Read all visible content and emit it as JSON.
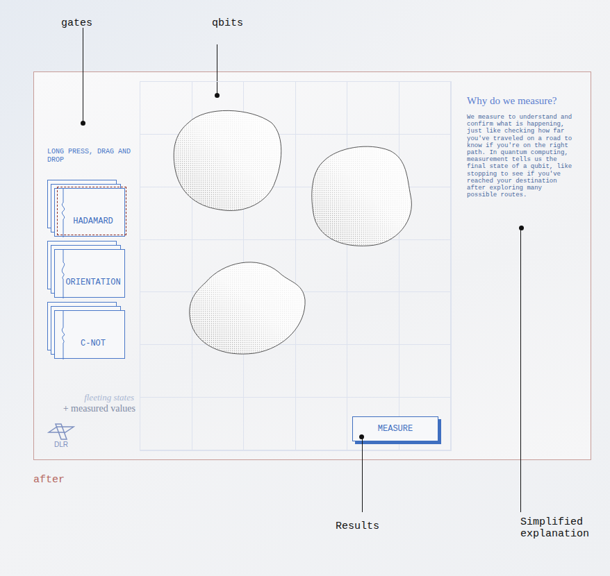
{
  "annotations": {
    "gates": "gates",
    "qbits": "qbits",
    "results": "Results",
    "explanation": "Simplified explanation"
  },
  "caption": "after",
  "sidebar": {
    "hint": "LONG PRESS, DRAG AND DROP",
    "gates": [
      {
        "label": "HADAMARD",
        "selected": true
      },
      {
        "label": "ORIENTATION",
        "selected": false
      },
      {
        "label": "C-NOT",
        "selected": false
      }
    ],
    "tagline_1": "fleeting states",
    "tagline_2": "+ measured values",
    "logo": "DLR"
  },
  "canvas": {
    "qubits": [
      {
        "kind": "blob"
      },
      {
        "kind": "blob"
      },
      {
        "kind": "blob"
      }
    ],
    "button": "MEASURE"
  },
  "explanation": {
    "title": "Why do we measure?",
    "body": "We measure to understand and confirm what is happening, just like checking how far you've traveled on a road to know if you're on the right path. In quantum computing, measurement tells us the final state of a qubit, like stopping to see if you've reached your destination after exploring many possible routes."
  }
}
